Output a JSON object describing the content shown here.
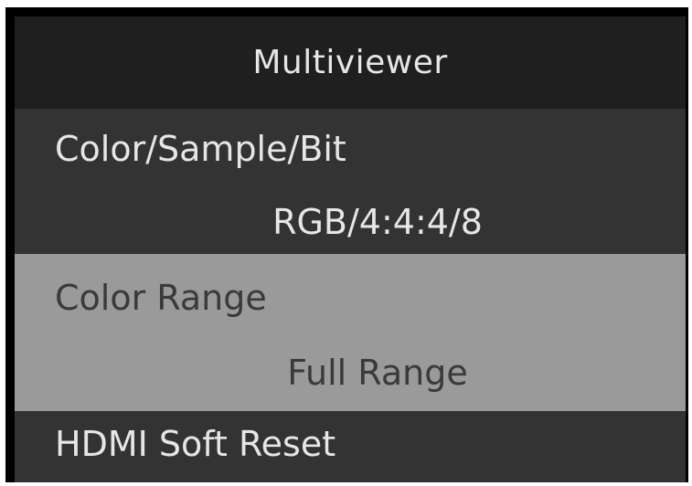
{
  "menu": {
    "title": "Multiviewer",
    "items": [
      {
        "label": "Color/Sample/Bit",
        "value": "RGB/4:4:4/8",
        "selected": false
      },
      {
        "label": "Color Range",
        "value": "Full Range",
        "selected": true
      },
      {
        "label": "HDMI Soft Reset",
        "selected": false
      }
    ]
  },
  "colors": {
    "frame": "#000000",
    "title_bg": "#1f1f1f",
    "row_bg": "#333333",
    "selected_bg": "#9a9a9a",
    "text": "#e6e6e6",
    "selected_text": "#3a3a3a"
  }
}
